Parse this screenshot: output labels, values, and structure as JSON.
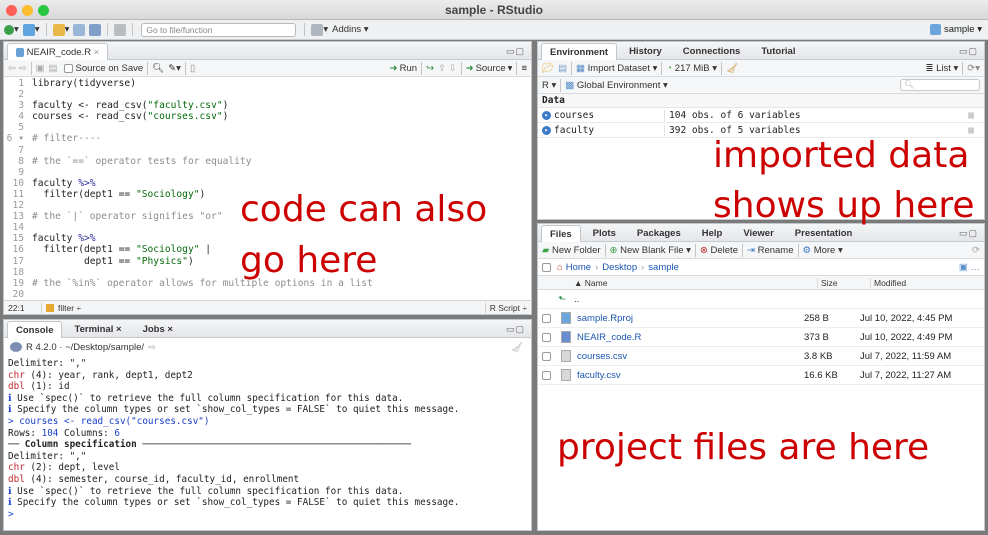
{
  "window": {
    "title": "sample - RStudio"
  },
  "toolbar": {
    "goto_placeholder": "Go to file/function",
    "addins": "Addins ▾",
    "project": "sample ▾"
  },
  "colors": {
    "accent": "#c00000",
    "close": "#ff5f57",
    "minimize": "#febc2e",
    "maximize": "#28c840"
  },
  "editor": {
    "tab": "NEAIR_code.R",
    "source_on_save": "Source on Save",
    "run": "Run",
    "source": "Source",
    "lines": [
      {
        "n": "1",
        "t": "library(tidyverse)"
      },
      {
        "n": "2",
        "t": ""
      },
      {
        "n": "3",
        "t": "faculty <- read_csv(\"faculty.csv\")"
      },
      {
        "n": "4",
        "t": "courses <- read_csv(\"courses.csv\")"
      },
      {
        "n": "5",
        "t": ""
      },
      {
        "n": "6 ▾",
        "t": "# filter----"
      },
      {
        "n": "7",
        "t": ""
      },
      {
        "n": "8",
        "t": "# the `==` operator tests for equality"
      },
      {
        "n": "9",
        "t": ""
      },
      {
        "n": "10",
        "t": "faculty %>%"
      },
      {
        "n": "11",
        "t": "  filter(dept1 == \"Sociology\")"
      },
      {
        "n": "12",
        "t": ""
      },
      {
        "n": "13",
        "t": "# the `|` operator signifies \"or\""
      },
      {
        "n": "14",
        "t": ""
      },
      {
        "n": "15",
        "t": "faculty %>%"
      },
      {
        "n": "16",
        "t": "  filter(dept1 == \"Sociology\" |"
      },
      {
        "n": "17",
        "t": "         dept1 == \"Physics\")"
      },
      {
        "n": "18",
        "t": ""
      },
      {
        "n": "19",
        "t": "# the `%in%` operator allows for multiple options in a list"
      },
      {
        "n": "20",
        "t": ""
      }
    ],
    "status_pos": "22:1",
    "status_scope": "filter ÷",
    "status_type": "R Script ÷"
  },
  "console": {
    "tabs": [
      "Console",
      "Terminal ×",
      "Jobs ×"
    ],
    "header": "R 4.2.0 · ~/Desktop/sample/",
    "lines": [
      {
        "t": "Delimiter: \",\"",
        "c": ""
      },
      {
        "t": "chr (4): year, rank, dept1, dept2",
        "c": ""
      },
      {
        "t": "dbl (1): id",
        "c": ""
      },
      {
        "t": "",
        "c": ""
      },
      {
        "t": "ℹ Use `spec()` to retrieve the full column specification for this data.",
        "c": ""
      },
      {
        "t": "ℹ Specify the column types or set `show_col_types = FALSE` to quiet this message.",
        "c": ""
      },
      {
        "t": "> courses <- read_csv(\"courses.csv\")",
        "c": "blue"
      },
      {
        "t": "Rows: 104 Columns: 6",
        "c": ""
      },
      {
        "t": "── Column specification ────────────────────────────────────────────────",
        "c": "bold"
      },
      {
        "t": "Delimiter: \",\"",
        "c": ""
      },
      {
        "t": "chr (2): dept, level",
        "c": ""
      },
      {
        "t": "dbl (4): semester, course_id, faculty_id, enrollment",
        "c": ""
      },
      {
        "t": "",
        "c": ""
      },
      {
        "t": "ℹ Use `spec()` to retrieve the full column specification for this data.",
        "c": ""
      },
      {
        "t": "ℹ Specify the column types or set `show_col_types = FALSE` to quiet this message.",
        "c": ""
      },
      {
        "t": ">",
        "c": "blue"
      }
    ]
  },
  "environment": {
    "tabs": [
      "Environment",
      "History",
      "Connections",
      "Tutorial"
    ],
    "import": "Import Dataset ▾",
    "memory": "217 MiB ▾",
    "list": "List ▾",
    "lang": "R ▾",
    "scope": "Global Environment ▾",
    "section": "Data",
    "rows": [
      {
        "name": "courses",
        "value": "104 obs. of 6 variables"
      },
      {
        "name": "faculty",
        "value": "392 obs. of 5 variables"
      }
    ]
  },
  "files": {
    "tabs": [
      "Files",
      "Plots",
      "Packages",
      "Help",
      "Viewer",
      "Presentation"
    ],
    "new_folder": "New Folder",
    "new_blank": "New Blank File ▾",
    "delete": "Delete",
    "rename": "Rename",
    "more": "More ▾",
    "crumbs": [
      "Home",
      "Desktop",
      "sample"
    ],
    "headers": {
      "name": "▲ Name",
      "size": "Size",
      "modified": "Modified"
    },
    "up": "..",
    "rows": [
      {
        "name": "sample.Rproj",
        "size": "258 B",
        "modified": "Jul 10, 2022, 4:45 PM"
      },
      {
        "name": "NEAIR_code.R",
        "size": "373 B",
        "modified": "Jul 10, 2022, 4:49 PM"
      },
      {
        "name": "courses.csv",
        "size": "3.8 KB",
        "modified": "Jul 7, 2022, 11:59 AM"
      },
      {
        "name": "faculty.csv",
        "size": "16.6 KB",
        "modified": "Jul 7, 2022, 11:27 AM"
      }
    ]
  },
  "annotations": {
    "code_line1": "code can also",
    "code_line2": "go here",
    "data_line1": "imported data",
    "data_line2": "shows up here",
    "files": "project files are here"
  }
}
